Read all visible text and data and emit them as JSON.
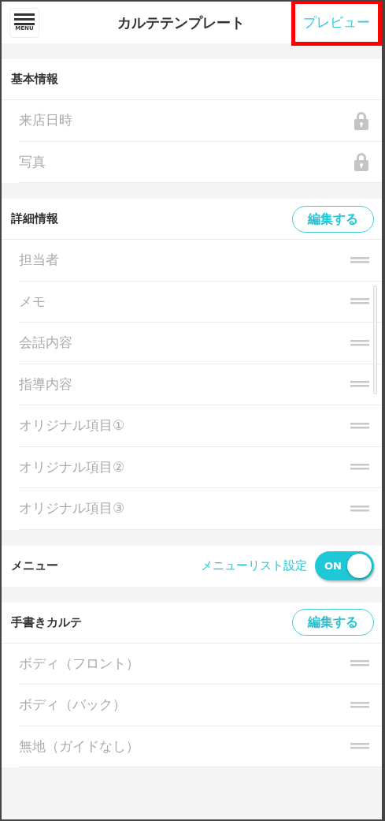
{
  "header": {
    "menu_label": "MENU",
    "title": "カルテテンプレート",
    "preview": {
      "label": "プレビュー",
      "highlighted": true
    }
  },
  "sections": [
    {
      "kind": "list",
      "title": "基本情報",
      "items": [
        {
          "label": "来店日時",
          "kind": "locked"
        },
        {
          "label": "写真",
          "kind": "locked"
        }
      ]
    },
    {
      "kind": "list",
      "title": "詳細情報",
      "edit_button": "編集する",
      "scrollbar": true,
      "items": [
        {
          "label": "担当者",
          "kind": "draggable"
        },
        {
          "label": "メモ",
          "kind": "draggable"
        },
        {
          "label": "会話内容",
          "kind": "draggable"
        },
        {
          "label": "指導内容",
          "kind": "draggable"
        },
        {
          "label": "オリジナル項目①",
          "kind": "draggable"
        },
        {
          "label": "オリジナル項目②",
          "kind": "draggable"
        },
        {
          "label": "オリジナル項目③",
          "kind": "draggable"
        }
      ]
    },
    {
      "kind": "toggle",
      "title": "メニュー",
      "link": "メニューリスト設定",
      "toggle": {
        "on": true,
        "label": "ON"
      }
    },
    {
      "kind": "list",
      "title": "手書きカルテ",
      "edit_button": "編集する",
      "items": [
        {
          "label": "ボディ（フロント）",
          "kind": "draggable"
        },
        {
          "label": "ボディ（バック）",
          "kind": "draggable"
        },
        {
          "label": "無地（ガイドなし）",
          "kind": "draggable"
        }
      ]
    }
  ]
}
